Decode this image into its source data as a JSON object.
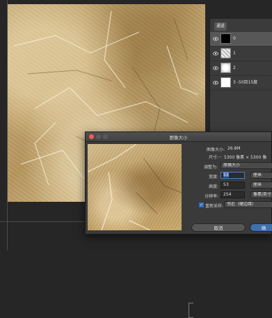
{
  "layers_panel": {
    "tab_label": "通道",
    "layers": [
      {
        "name": "0",
        "selected": true
      },
      {
        "name": "1",
        "selected": false
      },
      {
        "name": "2",
        "selected": false
      },
      {
        "name": "3 -50目15度",
        "selected": false
      }
    ]
  },
  "dialog": {
    "title": "图像大小",
    "image_size_label": "图像大小:",
    "image_size_value": "26.8M",
    "dimensions_label": "尺寸:",
    "dimensions_value": "5300 像素 × 5300 像",
    "fit_label": "调整为:",
    "fit_value": "原稿大小",
    "width_label": "宽度:",
    "width_value": "53",
    "width_unit": "厘米",
    "height_label": "高度:",
    "height_value": "53",
    "height_unit": "厘米",
    "resolution_label": "分辨率:",
    "resolution_value": "254",
    "resolution_unit": "像素/英寸",
    "resample_label": "重新采样:",
    "resample_checked": true,
    "resample_value": "邻近（硬边缘）",
    "cancel_label": "取消",
    "ok_label": "确"
  }
}
